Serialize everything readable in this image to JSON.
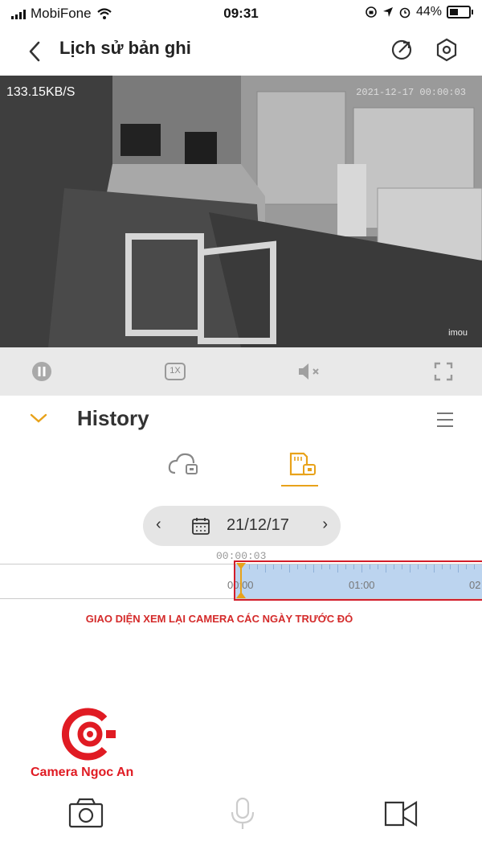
{
  "status_bar": {
    "carrier": "MobiFone",
    "time": "09:31",
    "battery": "44%"
  },
  "header": {
    "title": "Lịch sử bản ghi",
    "back_icon": "chevron-left-icon",
    "share_icon": "share-icon",
    "settings_icon": "settings-icon"
  },
  "video": {
    "bitrate": "133.15KB/S",
    "timestamp": "2021-12-17 00:00:03",
    "watermark": "imou"
  },
  "controls": {
    "pause_icon": "pause-icon",
    "speed": "1X",
    "mute_icon": "mute-icon",
    "fullscreen_icon": "fullscreen-icon"
  },
  "history": {
    "title": "History",
    "tabs": [
      {
        "name": "cloud",
        "icon": "cloud-icon",
        "active": false
      },
      {
        "name": "sd-card",
        "icon": "sd-card-icon",
        "active": true
      }
    ],
    "date": "21/12/17",
    "current_time": "00:00:03",
    "timeline_labels": [
      "00:00",
      "01:00",
      "02"
    ]
  },
  "caption": "GIAO DIỆN XEM LẠI CAMERA CÁC NGÀY TRƯỚC ĐÓ",
  "brand": "Camera Ngoc An",
  "colors": {
    "accent": "#e8a21a",
    "record": "#bcd4ef",
    "highlight": "#d21d2a",
    "brand": "#e01b23"
  },
  "bottom_bar": [
    {
      "icon": "camera-icon"
    },
    {
      "icon": "microphone-icon"
    },
    {
      "icon": "video-camera-icon"
    }
  ]
}
